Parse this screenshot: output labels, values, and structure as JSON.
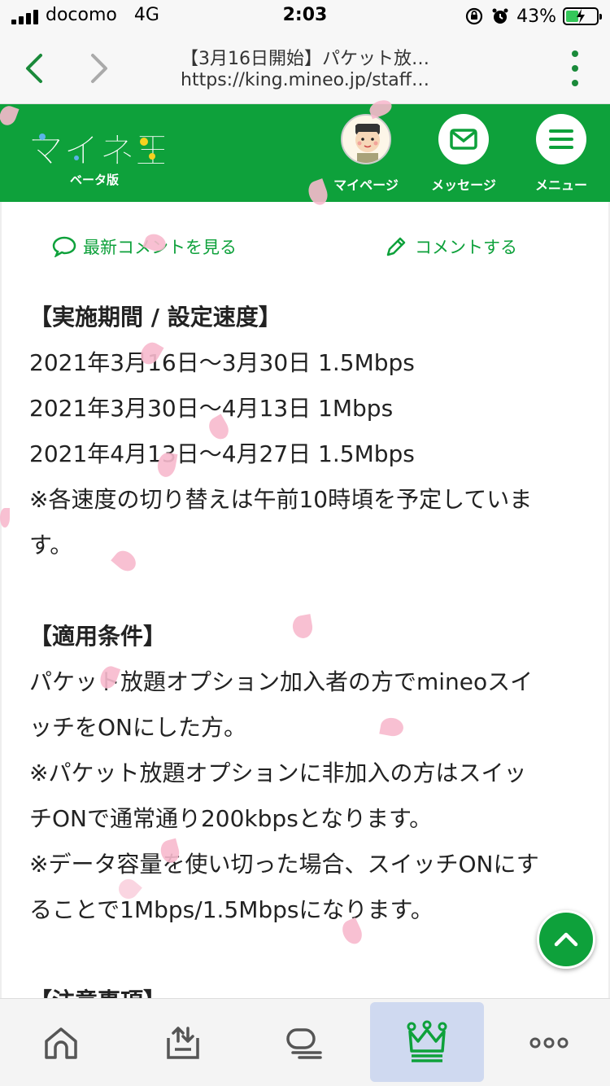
{
  "status_bar": {
    "carrier": "docomo",
    "network": "4G",
    "time": "2:03",
    "battery_percent": "43%",
    "battery_level": 0.43
  },
  "browser": {
    "title": "【3月16日開始】パケット放…",
    "url": "https://king.mineo.jp/staff…"
  },
  "site_header": {
    "logo_text": "マイネ王",
    "logo_sub": "ベータ版",
    "mypage_label": "マイページ",
    "message_label": "メッセージ",
    "menu_label": "メニュー"
  },
  "actions": {
    "latest_comments": "最新コメントを見る",
    "post_comment": "コメントする"
  },
  "article_lines": [
    "【実施期間 / 設定速度】",
    "2021年3月16日〜3月30日 1.5Mbps",
    "2021年3月30日〜4月13日 1Mbps",
    "2021年4月13日〜4月27日 1.5Mbps",
    "※各速度の切り替えは午前10時頃を予定していま",
    "す。",
    "",
    "【適用条件】",
    "パケット放題オプション加入者の方でmineoスイ",
    "ッチをONにした方。",
    "※パケット放題オプションに非加入の方はスイッ",
    "チONで通常通り200kbpsとなります。",
    "※データ容量を使い切った場合、スイッチONにす",
    "ることで1Mbps/1.5Mbpsになります。",
    "",
    "【注意事項】"
  ],
  "icons": {
    "back": "chevron-left-icon",
    "forward": "chevron-right-icon",
    "more": "kebab-icon",
    "message": "envelope-icon",
    "menu": "hamburger-icon",
    "scroll_top": "chevron-up-icon",
    "tabs": [
      "home-icon",
      "upload-icon",
      "chat-icon",
      "crown-icon",
      "more-dots-icon"
    ]
  },
  "colors": {
    "brand_green": "#0ea13b",
    "petal_pink": "#f7b9cd",
    "active_tab": "#cfd9f0"
  }
}
